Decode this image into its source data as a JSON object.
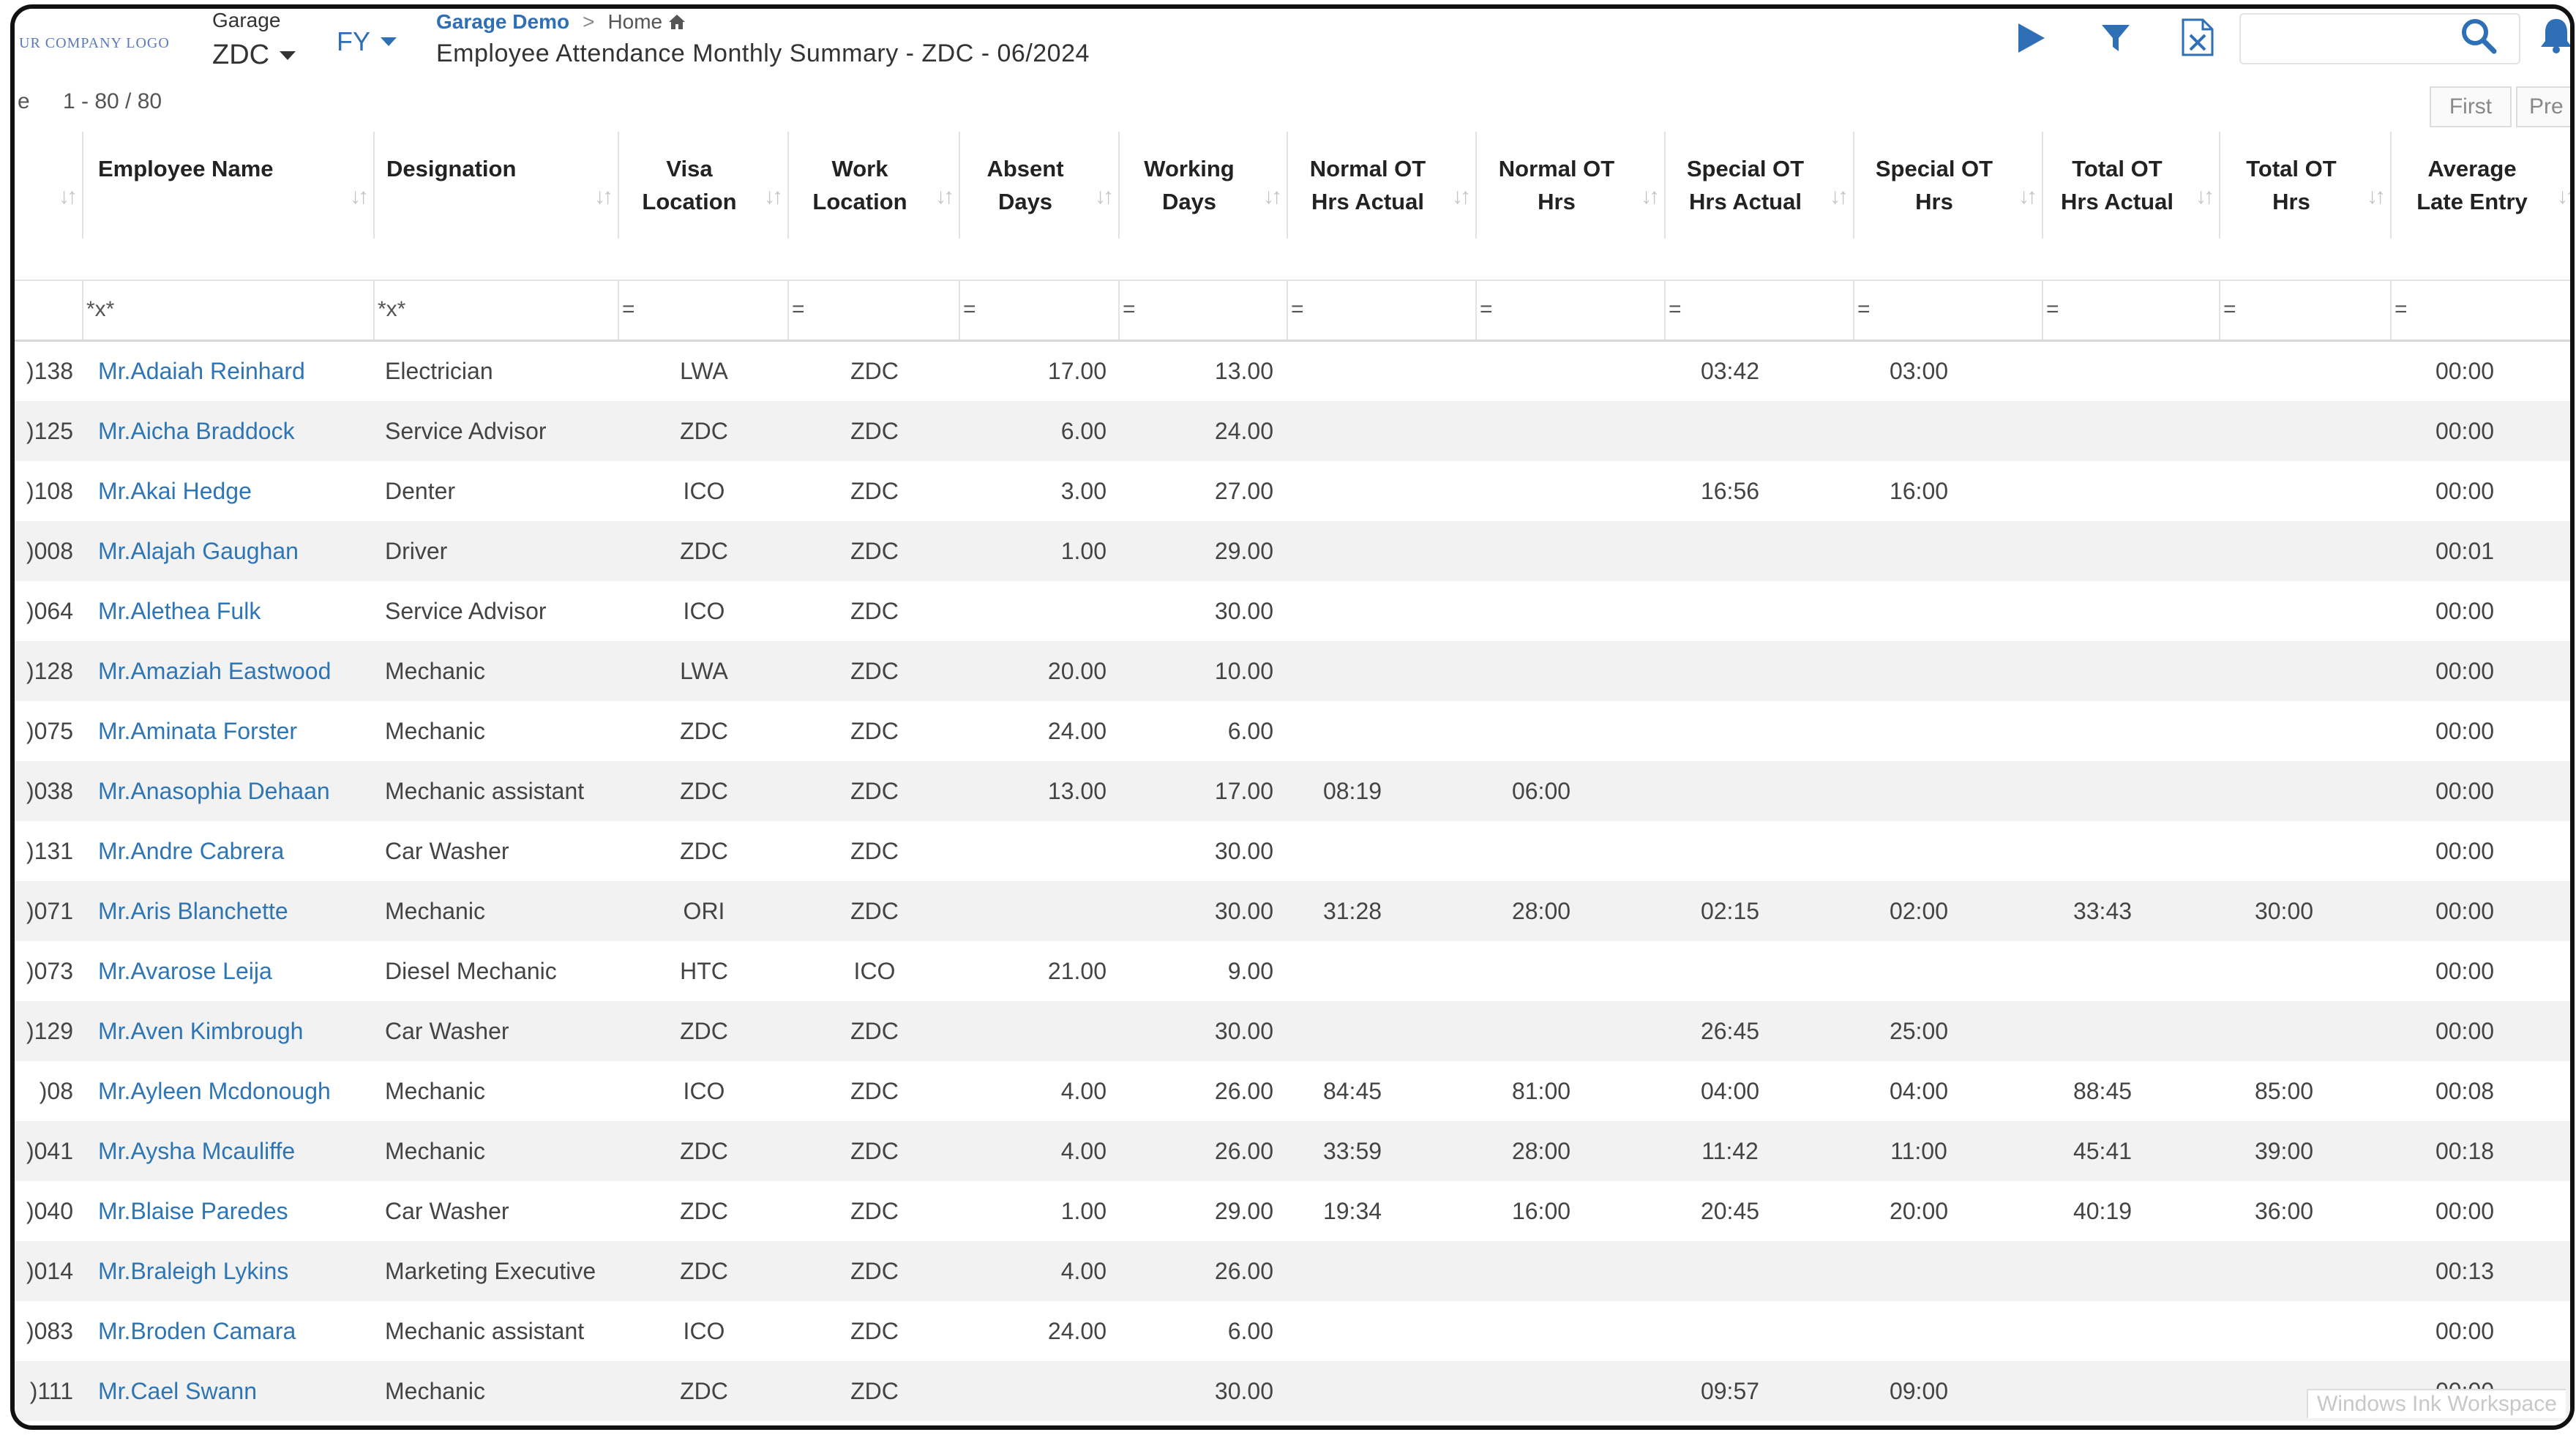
{
  "header": {
    "logo_text": "UR COMPANY LOGO",
    "garage_label": "Garage",
    "garage_value": "ZDC",
    "fy_label": "FY",
    "breadcrumb_link": "Garage Demo",
    "breadcrumb_sep": ">",
    "breadcrumb_home": "Home",
    "title": "Employee Attendance Monthly Summary - ZDC - 06/2024",
    "icons": [
      "play-icon",
      "filter-icon",
      "excel-export-icon",
      "search-icon",
      "bell-icon"
    ],
    "search_value": ""
  },
  "pager": {
    "left_fragment": "e",
    "range": "1 - 80 / 80",
    "first_label": "First",
    "prev_label": "Pre"
  },
  "columns": [
    {
      "key": "code",
      "label": ""
    },
    {
      "key": "name",
      "label": "Employee Name"
    },
    {
      "key": "designation",
      "label": "Designation"
    },
    {
      "key": "visa",
      "label": "Visa\nLocation"
    },
    {
      "key": "work",
      "label": "Work\nLocation"
    },
    {
      "key": "absent",
      "label": "Absent\nDays"
    },
    {
      "key": "working",
      "label": "Working\nDays"
    },
    {
      "key": "normal_ot_actual",
      "label": "Normal OT\nHrs Actual"
    },
    {
      "key": "normal_ot",
      "label": "Normal OT\nHrs"
    },
    {
      "key": "special_ot_actual",
      "label": "Special OT\nHrs Actual"
    },
    {
      "key": "special_ot",
      "label": "Special OT\nHrs"
    },
    {
      "key": "total_ot_actual",
      "label": "Total OT\nHrs Actual"
    },
    {
      "key": "total_ot",
      "label": "Total OT\nHrs"
    },
    {
      "key": "late",
      "label": "Average\nLate Entry"
    }
  ],
  "filters": [
    "",
    "*x*",
    "*x*",
    "=",
    "=",
    "=",
    "=",
    "=",
    "=",
    "=",
    "=",
    "=",
    "=",
    "="
  ],
  "rows": [
    {
      "code": ")138",
      "name": "Mr.Adaiah Reinhard",
      "designation": "Electrician",
      "visa": "LWA",
      "work": "ZDC",
      "absent": "17.00",
      "working": "13.00",
      "normal_ot_actual": "",
      "normal_ot": "",
      "special_ot_actual": "03:42",
      "special_ot": "03:00",
      "total_ot_actual": "",
      "total_ot": "",
      "late": "00:00"
    },
    {
      "code": ")125",
      "name": "Mr.Aicha Braddock",
      "designation": "Service Advisor",
      "visa": "ZDC",
      "work": "ZDC",
      "absent": "6.00",
      "working": "24.00",
      "normal_ot_actual": "",
      "normal_ot": "",
      "special_ot_actual": "",
      "special_ot": "",
      "total_ot_actual": "",
      "total_ot": "",
      "late": "00:00"
    },
    {
      "code": ")108",
      "name": "Mr.Akai Hedge",
      "designation": "Denter",
      "visa": "ICO",
      "work": "ZDC",
      "absent": "3.00",
      "working": "27.00",
      "normal_ot_actual": "",
      "normal_ot": "",
      "special_ot_actual": "16:56",
      "special_ot": "16:00",
      "total_ot_actual": "",
      "total_ot": "",
      "late": "00:00"
    },
    {
      "code": ")008",
      "name": "Mr.Alajah Gaughan",
      "designation": "Driver",
      "visa": "ZDC",
      "work": "ZDC",
      "absent": "1.00",
      "working": "29.00",
      "normal_ot_actual": "",
      "normal_ot": "",
      "special_ot_actual": "",
      "special_ot": "",
      "total_ot_actual": "",
      "total_ot": "",
      "late": "00:01"
    },
    {
      "code": ")064",
      "name": "Mr.Alethea Fulk",
      "designation": "Service Advisor",
      "visa": "ICO",
      "work": "ZDC",
      "absent": "",
      "working": "30.00",
      "normal_ot_actual": "",
      "normal_ot": "",
      "special_ot_actual": "",
      "special_ot": "",
      "total_ot_actual": "",
      "total_ot": "",
      "late": "00:00"
    },
    {
      "code": ")128",
      "name": "Mr.Amaziah Eastwood",
      "designation": "Mechanic",
      "visa": "LWA",
      "work": "ZDC",
      "absent": "20.00",
      "working": "10.00",
      "normal_ot_actual": "",
      "normal_ot": "",
      "special_ot_actual": "",
      "special_ot": "",
      "total_ot_actual": "",
      "total_ot": "",
      "late": "00:00"
    },
    {
      "code": ")075",
      "name": "Mr.Aminata Forster",
      "designation": "Mechanic",
      "visa": "ZDC",
      "work": "ZDC",
      "absent": "24.00",
      "working": "6.00",
      "normal_ot_actual": "",
      "normal_ot": "",
      "special_ot_actual": "",
      "special_ot": "",
      "total_ot_actual": "",
      "total_ot": "",
      "late": "00:00"
    },
    {
      "code": ")038",
      "name": "Mr.Anasophia Dehaan",
      "designation": "Mechanic assistant",
      "visa": "ZDC",
      "work": "ZDC",
      "absent": "13.00",
      "working": "17.00",
      "normal_ot_actual": "08:19",
      "normal_ot": "06:00",
      "special_ot_actual": "",
      "special_ot": "",
      "total_ot_actual": "",
      "total_ot": "",
      "late": "00:00"
    },
    {
      "code": ")131",
      "name": "Mr.Andre Cabrera",
      "designation": "Car Washer",
      "visa": "ZDC",
      "work": "ZDC",
      "absent": "",
      "working": "30.00",
      "normal_ot_actual": "",
      "normal_ot": "",
      "special_ot_actual": "",
      "special_ot": "",
      "total_ot_actual": "",
      "total_ot": "",
      "late": "00:00"
    },
    {
      "code": ")071",
      "name": "Mr.Aris Blanchette",
      "designation": "Mechanic",
      "visa": "ORI",
      "work": "ZDC",
      "absent": "",
      "working": "30.00",
      "normal_ot_actual": "31:28",
      "normal_ot": "28:00",
      "special_ot_actual": "02:15",
      "special_ot": "02:00",
      "total_ot_actual": "33:43",
      "total_ot": "30:00",
      "late": "00:00"
    },
    {
      "code": ")073",
      "name": "Mr.Avarose Leija",
      "designation": "Diesel Mechanic",
      "visa": "HTC",
      "work": "ICO",
      "absent": "21.00",
      "working": "9.00",
      "normal_ot_actual": "",
      "normal_ot": "",
      "special_ot_actual": "",
      "special_ot": "",
      "total_ot_actual": "",
      "total_ot": "",
      "late": "00:00"
    },
    {
      "code": ")129",
      "name": "Mr.Aven Kimbrough",
      "designation": "Car Washer",
      "visa": "ZDC",
      "work": "ZDC",
      "absent": "",
      "working": "30.00",
      "normal_ot_actual": "",
      "normal_ot": "",
      "special_ot_actual": "26:45",
      "special_ot": "25:00",
      "total_ot_actual": "",
      "total_ot": "",
      "late": "00:00"
    },
    {
      "code": ")08",
      "name": "Mr.Ayleen Mcdonough",
      "designation": "Mechanic",
      "visa": "ICO",
      "work": "ZDC",
      "absent": "4.00",
      "working": "26.00",
      "normal_ot_actual": "84:45",
      "normal_ot": "81:00",
      "special_ot_actual": "04:00",
      "special_ot": "04:00",
      "total_ot_actual": "88:45",
      "total_ot": "85:00",
      "late": "00:08"
    },
    {
      "code": ")041",
      "name": "Mr.Aysha Mcauliffe",
      "designation": "Mechanic",
      "visa": "ZDC",
      "work": "ZDC",
      "absent": "4.00",
      "working": "26.00",
      "normal_ot_actual": "33:59",
      "normal_ot": "28:00",
      "special_ot_actual": "11:42",
      "special_ot": "11:00",
      "total_ot_actual": "45:41",
      "total_ot": "39:00",
      "late": "00:18"
    },
    {
      "code": ")040",
      "name": "Mr.Blaise Paredes",
      "designation": "Car Washer",
      "visa": "ZDC",
      "work": "ZDC",
      "absent": "1.00",
      "working": "29.00",
      "normal_ot_actual": "19:34",
      "normal_ot": "16:00",
      "special_ot_actual": "20:45",
      "special_ot": "20:00",
      "total_ot_actual": "40:19",
      "total_ot": "36:00",
      "late": "00:00"
    },
    {
      "code": ")014",
      "name": "Mr.Braleigh Lykins",
      "designation": "Marketing Executive",
      "visa": "ZDC",
      "work": "ZDC",
      "absent": "4.00",
      "working": "26.00",
      "normal_ot_actual": "",
      "normal_ot": "",
      "special_ot_actual": "",
      "special_ot": "",
      "total_ot_actual": "",
      "total_ot": "",
      "late": "00:13"
    },
    {
      "code": ")083",
      "name": "Mr.Broden Camara",
      "designation": "Mechanic assistant",
      "visa": "ICO",
      "work": "ZDC",
      "absent": "24.00",
      "working": "6.00",
      "normal_ot_actual": "",
      "normal_ot": "",
      "special_ot_actual": "",
      "special_ot": "",
      "total_ot_actual": "",
      "total_ot": "",
      "late": "00:00"
    },
    {
      "code": ")111",
      "name": "Mr.Cael Swann",
      "designation": "Mechanic",
      "visa": "ZDC",
      "work": "ZDC",
      "absent": "",
      "working": "30.00",
      "normal_ot_actual": "",
      "normal_ot": "",
      "special_ot_actual": "09:57",
      "special_ot": "09:00",
      "total_ot_actual": "",
      "total_ot": "",
      "late": "00:00"
    }
  ],
  "watermark": "Windows Ink Workspace",
  "colors": {
    "link": "#2e75b6",
    "accent": "#2e6fb5",
    "row_alt": "#f2f2f2"
  }
}
